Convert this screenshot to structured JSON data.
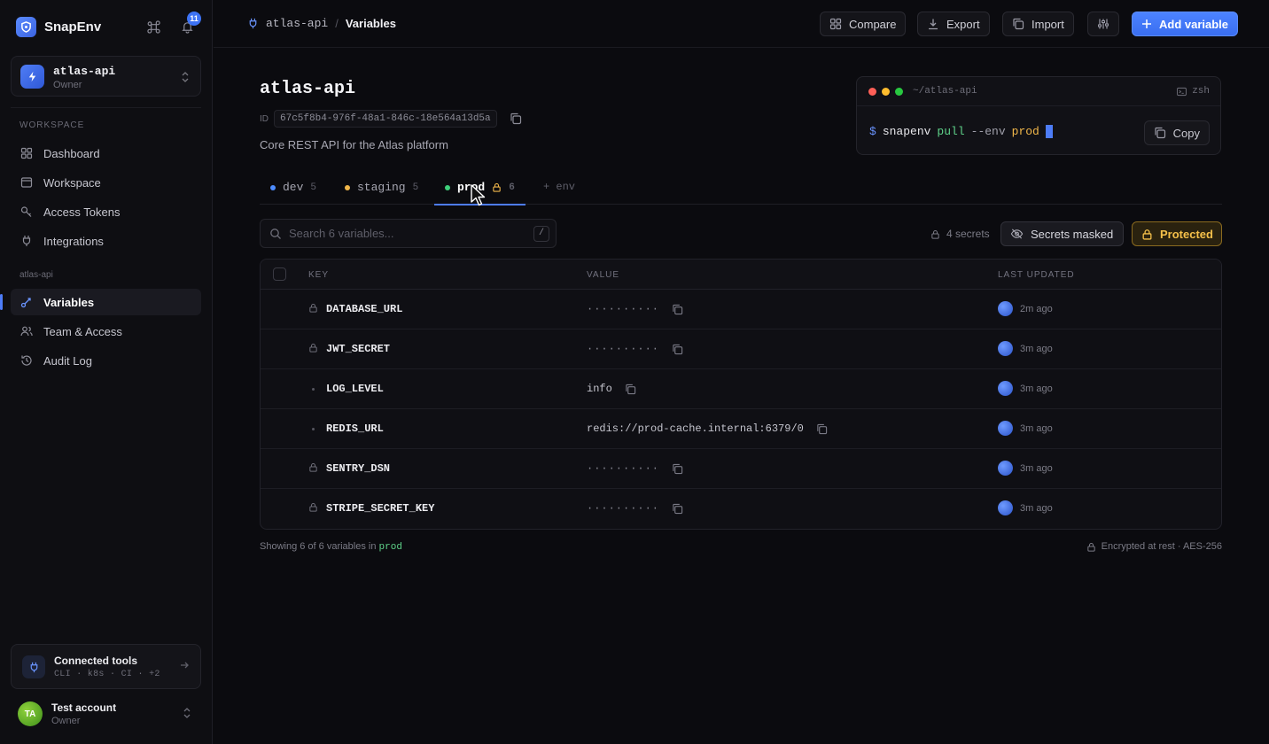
{
  "brand": {
    "name": "SnapEnv"
  },
  "notifications": {
    "count": "11"
  },
  "project_switcher": {
    "name": "atlas-api",
    "role": "Owner"
  },
  "sidebar": {
    "workspace_label": "WORKSPACE",
    "workspace_items": [
      {
        "label": "Dashboard",
        "icon": "grid-icon"
      },
      {
        "label": "Workspace",
        "icon": "folder-icon"
      },
      {
        "label": "Access Tokens",
        "icon": "key-icon"
      },
      {
        "label": "Integrations",
        "icon": "plug-icon"
      }
    ],
    "project_label": "atlas-api",
    "project_items": [
      {
        "label": "Variables",
        "icon": "variable-icon",
        "active": true
      },
      {
        "label": "Team & Access",
        "icon": "users-icon"
      },
      {
        "label": "Audit Log",
        "icon": "history-icon"
      }
    ]
  },
  "connected_tools": {
    "title": "Connected tools",
    "subtitle": "CLI · k8s · CI · +2"
  },
  "account": {
    "initials": "TA",
    "name": "Test account",
    "role": "Owner"
  },
  "breadcrumb": {
    "project": "atlas-api",
    "separator": "/",
    "current": "Variables"
  },
  "toolbar": {
    "compare_label": "Compare",
    "export_label": "Export",
    "import_label": "Import",
    "add_label": "Add variable"
  },
  "project": {
    "title": "atlas-api",
    "id_label": "ID",
    "id": "67c5f8b4-976f-48a1-846c-18e564a13d5a",
    "description": "Core REST API for the Atlas platform"
  },
  "terminal": {
    "path": "~/atlas-api",
    "shell": "zsh",
    "prompt": "$",
    "bin": "snapenv",
    "sub": "pull",
    "flag": "--env",
    "value": "prod",
    "copy_label": "Copy"
  },
  "tabs": [
    {
      "name": "dev",
      "count": "5",
      "color": "#4d8cff"
    },
    {
      "name": "staging",
      "count": "5",
      "color": "#f0b64a"
    },
    {
      "name": "prod",
      "count": "6",
      "color": "#3ecf7a",
      "active": true,
      "locked": true
    }
  ],
  "add_env_label": "+ env",
  "search": {
    "placeholder": "Search 6 variables...",
    "shortcut": "/"
  },
  "status": {
    "secrets_count": "4 secrets",
    "masked_label": "Secrets masked",
    "protected_label": "Protected"
  },
  "table": {
    "headers": {
      "key": "KEY",
      "value": "VALUE",
      "updated": "LAST UPDATED"
    },
    "rows": [
      {
        "key": "DATABASE_URL",
        "secret": true,
        "value": "··········",
        "updated": "2m ago"
      },
      {
        "key": "JWT_SECRET",
        "secret": true,
        "value": "··········",
        "updated": "3m ago"
      },
      {
        "key": "LOG_LEVEL",
        "secret": false,
        "value": "info",
        "updated": "3m ago"
      },
      {
        "key": "REDIS_URL",
        "secret": false,
        "value": "redis://prod-cache.internal:6379/0",
        "updated": "3m ago"
      },
      {
        "key": "SENTRY_DSN",
        "secret": true,
        "value": "··········",
        "updated": "3m ago"
      },
      {
        "key": "STRIPE_SECRET_KEY",
        "secret": true,
        "value": "··········",
        "updated": "3m ago"
      }
    ]
  },
  "footer": {
    "showing_prefix": "Showing 6 of 6 variables in",
    "env": "prod",
    "encryption": "Encrypted at rest · AES-256"
  }
}
